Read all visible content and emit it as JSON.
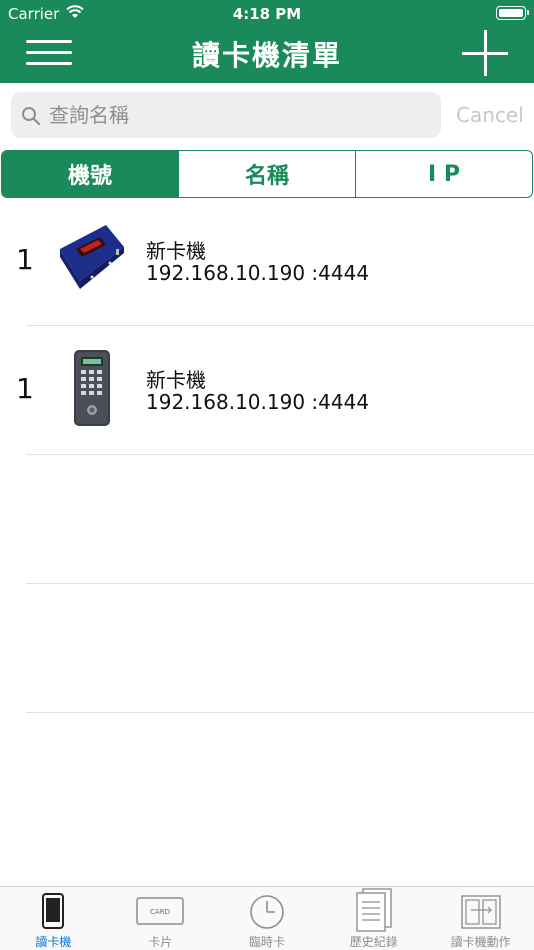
{
  "status": {
    "carrier": "Carrier",
    "time": "4:18 PM"
  },
  "nav": {
    "title": "讀卡機清單",
    "menu_icon": "hamburger-icon",
    "add_icon": "plus-icon"
  },
  "search": {
    "placeholder": "查詢名稱",
    "value": "",
    "cancel_label": "Cancel"
  },
  "segments": [
    {
      "label": "機號",
      "active": true
    },
    {
      "label": "名稱",
      "active": false
    },
    {
      "label": "I P",
      "active": false
    }
  ],
  "devices": [
    {
      "number": "1",
      "name": "新卡機",
      "address": "192.168.10.190 :4444",
      "image": "blue-card-reader"
    },
    {
      "number": "1",
      "name": "新卡機",
      "address": "192.168.10.190 :4444",
      "image": "keypad-card-reader"
    }
  ],
  "tabs": [
    {
      "label": "讀卡機",
      "icon": "phone-icon",
      "active": true
    },
    {
      "label": "卡片",
      "icon": "card-icon",
      "card_text": "CARD",
      "active": false
    },
    {
      "label": "臨時卡",
      "icon": "clock-icon",
      "active": false
    },
    {
      "label": "歷史紀錄",
      "icon": "document-icon",
      "active": false
    },
    {
      "label": "讀卡機動作",
      "icon": "doors-icon",
      "active": false
    }
  ],
  "colors": {
    "primary": "#1a8a5a",
    "tab_active": "#1476d2"
  }
}
